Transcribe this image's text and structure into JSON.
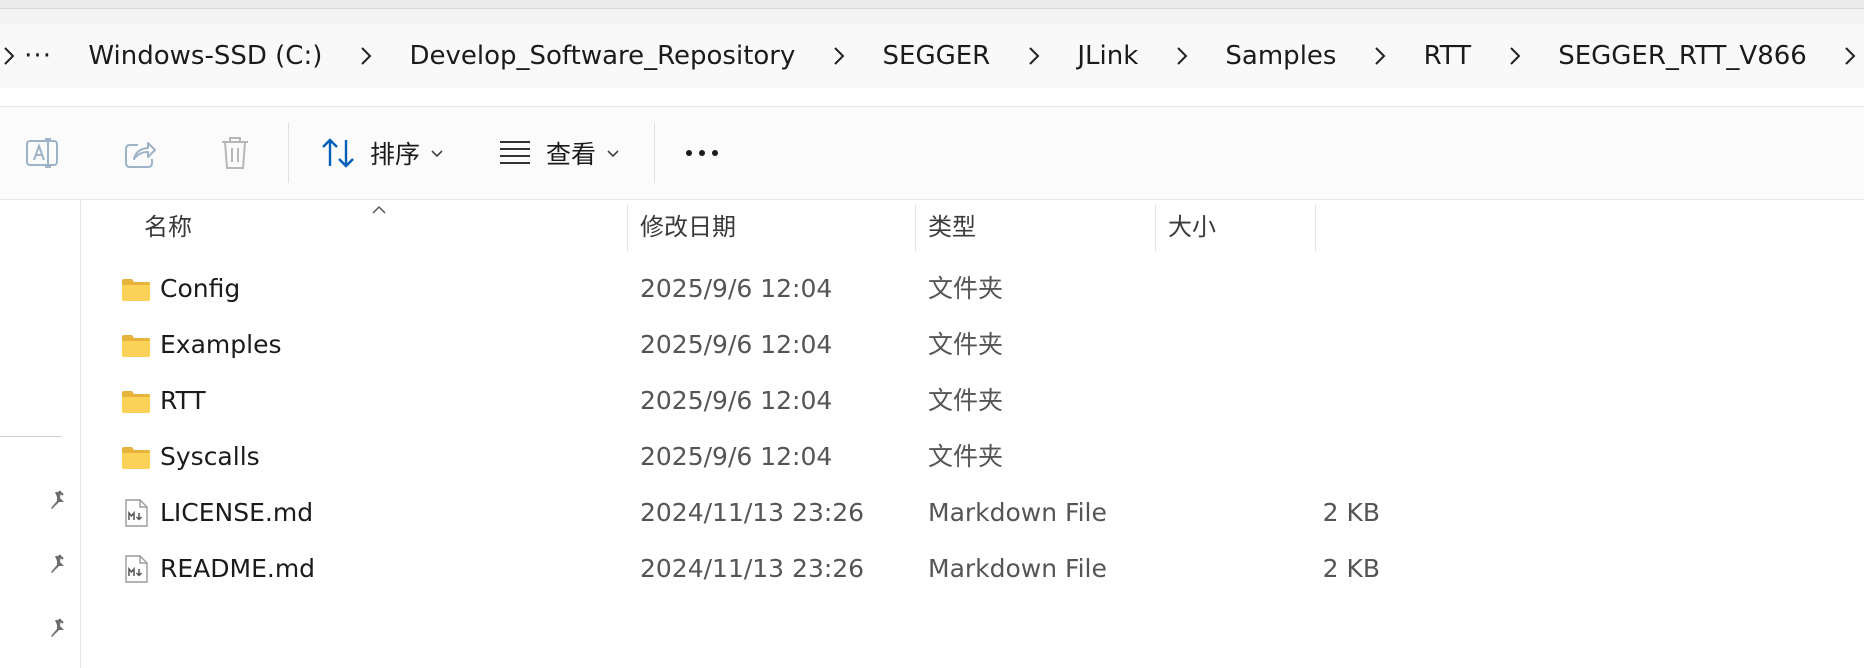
{
  "breadcrumb": {
    "more": "···",
    "items": [
      "Windows-SSD (C:)",
      "Develop_Software_Repository",
      "SEGGER",
      "JLink",
      "Samples",
      "RTT",
      "SEGGER_RTT_V866"
    ]
  },
  "toolbar": {
    "sort_label": "排序",
    "view_label": "查看",
    "more_label": "···"
  },
  "columns": {
    "name": "名称",
    "date": "修改日期",
    "type": "类型",
    "size": "大小"
  },
  "files": [
    {
      "name": "Config",
      "date": "2025/9/6 12:04",
      "type": "文件夹",
      "size": "",
      "icon": "folder-icon"
    },
    {
      "name": "Examples",
      "date": "2025/9/6 12:04",
      "type": "文件夹",
      "size": "",
      "icon": "folder-icon"
    },
    {
      "name": "RTT",
      "date": "2025/9/6 12:04",
      "type": "文件夹",
      "size": "",
      "icon": "folder-icon"
    },
    {
      "name": "Syscalls",
      "date": "2025/9/6 12:04",
      "type": "文件夹",
      "size": "",
      "icon": "folder-icon"
    },
    {
      "name": "LICENSE.md",
      "date": "2024/11/13 23:26",
      "type": "Markdown File",
      "size": "2 KB",
      "icon": "markdown-file-icon"
    },
    {
      "name": "README.md",
      "date": "2024/11/13 23:26",
      "type": "Markdown File",
      "size": "2 KB",
      "icon": "markdown-file-icon"
    }
  ],
  "colors": {
    "folder": "#f8c94d",
    "accent": "#005fb8",
    "disabled_icon": "#9fb3c8"
  }
}
